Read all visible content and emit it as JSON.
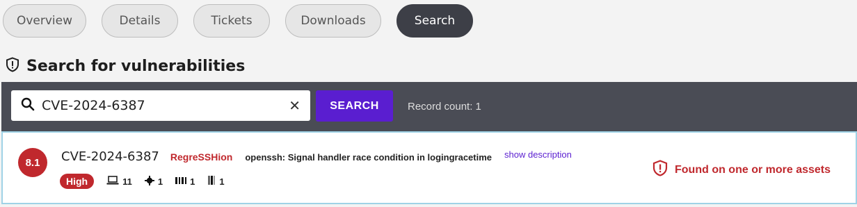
{
  "tabs": [
    {
      "label": "Overview"
    },
    {
      "label": "Details"
    },
    {
      "label": "Tickets"
    },
    {
      "label": "Downloads"
    },
    {
      "label": "Search",
      "active": true
    }
  ],
  "section": {
    "title": "Search for vulnerabilities",
    "icon": "shield-alert-icon"
  },
  "search": {
    "value": "CVE-2024-6387",
    "button_label": "SEARCH",
    "record_count": "Record count: 1"
  },
  "result": {
    "score": "8.1",
    "cve_id": "CVE-2024-6387",
    "nickname": "RegreSSHion",
    "description": "openssh: Signal handler race condition in logingracetime",
    "show_description": "show description",
    "severity": "High",
    "stats": [
      {
        "icon": "laptop-icon",
        "count": "11"
      },
      {
        "icon": "gear-icon",
        "count": "1"
      },
      {
        "icon": "barcode-icon",
        "count": "1"
      },
      {
        "icon": "server-icon",
        "count": "1"
      }
    ],
    "found_text": "Found on one or more assets"
  },
  "colors": {
    "accent": "#5a1ed0",
    "danger": "#c0282d",
    "bar": "#4a4c55"
  }
}
